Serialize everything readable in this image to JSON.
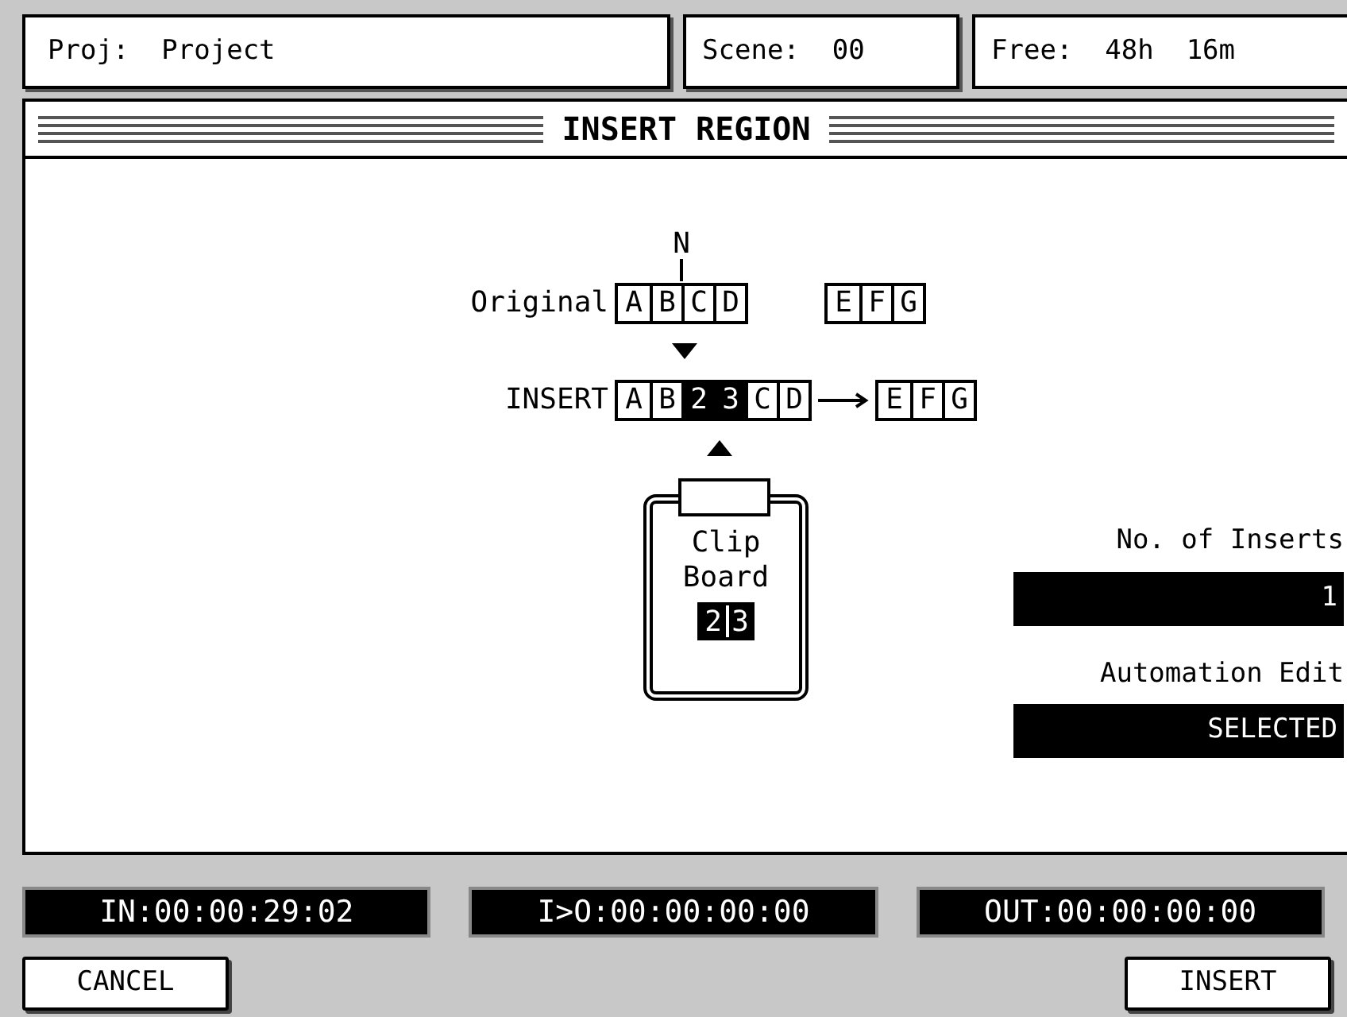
{
  "header": {
    "project": "Proj:  Project",
    "scene": "Scene:  00",
    "free": "Free:  48h  16m"
  },
  "title": "INSERT REGION",
  "diagram": {
    "marker": "N",
    "original_label": "Original",
    "original_blocks": [
      [
        {
          "text": "A",
          "highlighted": false
        },
        {
          "text": "B",
          "highlighted": false
        },
        {
          "text": "C",
          "highlighted": false
        },
        {
          "text": "D",
          "highlighted": false
        }
      ],
      [
        {
          "text": "E",
          "highlighted": false
        },
        {
          "text": "F",
          "highlighted": false
        },
        {
          "text": "G",
          "highlighted": false
        }
      ]
    ],
    "insert_label": "INSERT",
    "insert_blocks": [
      [
        {
          "text": "A",
          "highlighted": false
        },
        {
          "text": "B",
          "highlighted": false
        },
        {
          "text": "2",
          "highlighted": true
        },
        {
          "text": "3",
          "highlighted": true
        },
        {
          "text": "C",
          "highlighted": false
        },
        {
          "text": "D",
          "highlighted": false
        }
      ],
      [
        {
          "text": "E",
          "highlighted": false
        },
        {
          "text": "F",
          "highlighted": false
        },
        {
          "text": "G",
          "highlighted": false
        }
      ]
    ]
  },
  "clipboard": {
    "label_1": "Clip",
    "label_2": "Board",
    "cells": [
      {
        "text": "2",
        "highlighted": true
      },
      {
        "text": "3",
        "highlighted": true
      }
    ]
  },
  "fields": [
    {
      "label": "No. of Inserts",
      "value": "1"
    },
    {
      "label": "Automation Edit",
      "value": "SELECTED"
    }
  ],
  "timecodes": [
    "IN:00:00:29:02",
    "I>O:00:00:00:00",
    "OUT:00:00:00:00"
  ],
  "buttons": [
    "CANCEL",
    "INSERT"
  ]
}
